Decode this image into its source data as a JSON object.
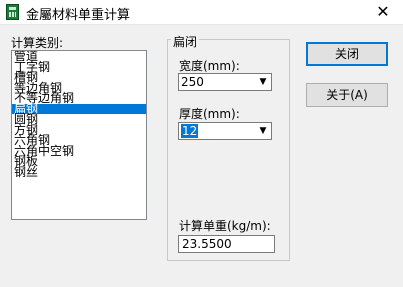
{
  "window": {
    "title": "金屬材料单重计算",
    "app_icon": "calculator-icon",
    "close_glyph": "✕"
  },
  "category": {
    "label": "计算类别:",
    "items": [
      "管道",
      "丁字钢",
      "槽钢",
      "等边角钢",
      "不等边角钢",
      "扁钢",
      "圆钢",
      "方钢",
      "六角钢",
      "六角中空钢",
      "钢板",
      "钢丝"
    ],
    "selected_index": 5
  },
  "group": {
    "title": "扁闭",
    "width_label": "宽度(mm):",
    "width_value": "250",
    "thickness_label": "厚度(mm):",
    "thickness_value": "12",
    "unit_weight_label": "计算单重(kg/m):",
    "unit_weight_value": "23.5500"
  },
  "buttons": {
    "close_label": "关闭",
    "about_label": "关于(A)"
  },
  "colors": {
    "selection": "#0078d7",
    "window_bg": "#f0f0f0"
  }
}
